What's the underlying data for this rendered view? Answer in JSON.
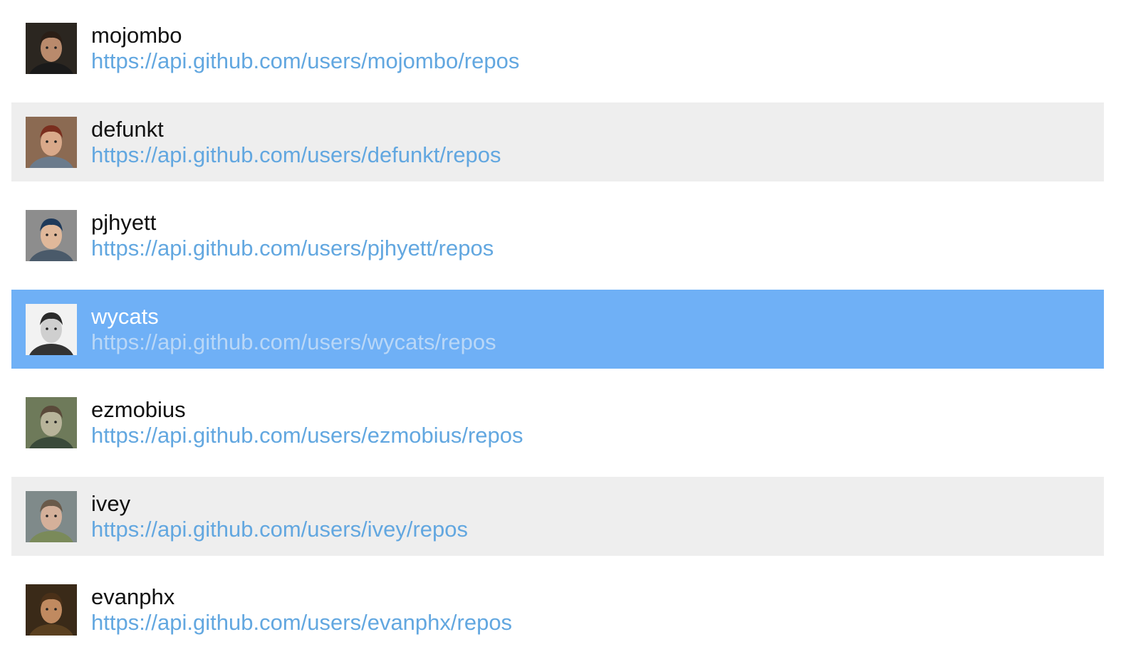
{
  "users": [
    {
      "login": "mojombo",
      "repos_url": "https://api.github.com/users/mojombo/repos",
      "row_style": "plain",
      "avatar": {
        "bg": "#2b2620",
        "skin": "#b98a6c",
        "hair": "#2a1e16",
        "shirt": "#1a1a1a"
      }
    },
    {
      "login": "defunkt",
      "repos_url": "https://api.github.com/users/defunkt/repos",
      "row_style": "alt",
      "avatar": {
        "bg": "#8b6a52",
        "skin": "#d9a98a",
        "hair": "#7a2e1e",
        "shirt": "#6b7b8c"
      }
    },
    {
      "login": "pjhyett",
      "repos_url": "https://api.github.com/users/pjhyett/repos",
      "row_style": "plain",
      "avatar": {
        "bg": "#8d8d8d",
        "skin": "#e0b89a",
        "hair": "#1f3a5a",
        "shirt": "#4a5a6a"
      }
    },
    {
      "login": "wycats",
      "repos_url": "https://api.github.com/users/wycats/repos",
      "row_style": "selected",
      "avatar": {
        "bg": "#f2f2f2",
        "skin": "#cfcfcf",
        "hair": "#2a2a2a",
        "shirt": "#333333"
      }
    },
    {
      "login": "ezmobius",
      "repos_url": "https://api.github.com/users/ezmobius/repos",
      "row_style": "plain",
      "avatar": {
        "bg": "#6e7a5a",
        "skin": "#b8b49a",
        "hair": "#5a4a3a",
        "shirt": "#3a4a3a"
      }
    },
    {
      "login": "ivey",
      "repos_url": "https://api.github.com/users/ivey/repos",
      "row_style": "alt",
      "avatar": {
        "bg": "#7f8a8a",
        "skin": "#d4b09a",
        "hair": "#6a5a4a",
        "shirt": "#7a8a5a"
      }
    },
    {
      "login": "evanphx",
      "repos_url": "https://api.github.com/users/evanphx/repos",
      "row_style": "plain",
      "avatar": {
        "bg": "#3a2a18",
        "skin": "#c08a60",
        "hair": "#4a3018",
        "shirt": "#5a4020"
      }
    }
  ],
  "colors": {
    "link": "#62a7e0",
    "selected_bg": "#6fb0f6",
    "alt_bg": "#eeeeee"
  }
}
